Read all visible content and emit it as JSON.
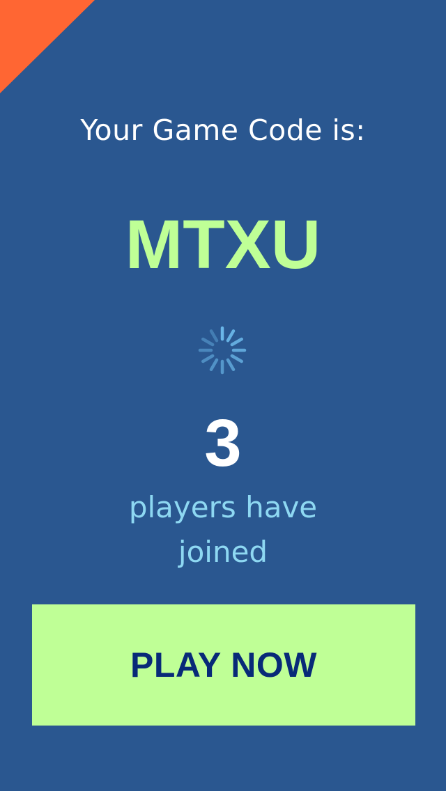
{
  "header": {
    "title": "Your Game Code is:"
  },
  "game": {
    "code": "MTXU",
    "players_joined": "3",
    "players_label": "players have joined"
  },
  "actions": {
    "play_label": "PLAY NOW"
  },
  "icons": {
    "spinner": "loading-spinner-icon",
    "corner": "corner-triangle"
  },
  "colors": {
    "background": "#2a5790",
    "corner": "#ff6633",
    "accent": "#bfff96",
    "button_text": "#082a78",
    "secondary_text": "#8ed8f2",
    "spinner": "#6ab6e8"
  }
}
